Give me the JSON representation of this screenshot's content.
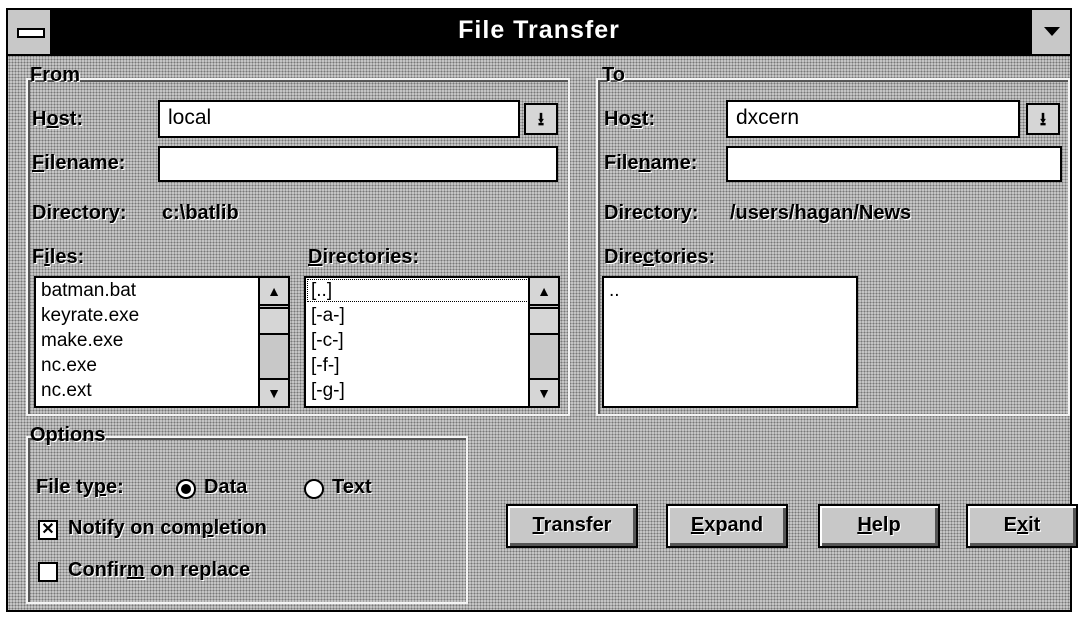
{
  "window": {
    "title": "File Transfer"
  },
  "from": {
    "group_label": "From",
    "host_label": "Host:",
    "host_value": "local",
    "filename_label": "Filename:",
    "filename_value": "",
    "directory_label": "Directory:",
    "directory_value": "c:\\batlib",
    "files_label": "Files:",
    "files": [
      "batman.bat",
      "keyrate.exe",
      "make.exe",
      "nc.exe",
      "nc.ext"
    ],
    "directories_label": "Directories:",
    "directories": [
      "[..]",
      "[-a-]",
      "[-c-]",
      "[-f-]",
      "[-g-]"
    ]
  },
  "to": {
    "group_label": "To",
    "host_label": "Host:",
    "host_value": "dxcern",
    "filename_label": "Filename:",
    "filename_value": "",
    "directory_label": "Directory:",
    "directory_value": "/users/hagan/News",
    "directories_label": "Directories:",
    "directories": [
      ".."
    ]
  },
  "options": {
    "group_label": "Options",
    "file_type_label": "File type:",
    "file_type_options": [
      "Data",
      "Text"
    ],
    "file_type_selected": "Data",
    "notify_label": "Notify on completion",
    "notify_checked": true,
    "confirm_label": "Confirm on replace",
    "confirm_checked": false
  },
  "buttons": {
    "transfer": "Transfer",
    "expand": "Expand",
    "help": "Help",
    "exit": "Exit"
  },
  "icons": {
    "system_menu": "system-menu-icon",
    "minimize": "minimize-icon",
    "combo_arrow": "dropdown-arrow-icon",
    "scroll_up": "scroll-up-icon",
    "scroll_down": "scroll-down-icon"
  }
}
